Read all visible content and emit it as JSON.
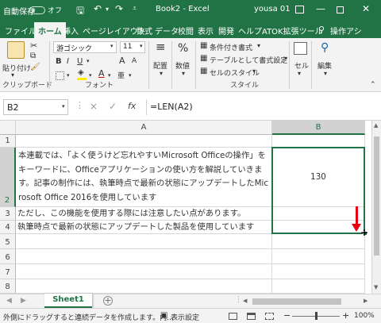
{
  "titlebar": {
    "autosave": "自動保存",
    "autosave_state": "オフ",
    "title": "Book2  -  Excel",
    "user": "yousa 01"
  },
  "tabs": [
    "ファイル",
    "ホーム",
    "挿入",
    "ページレイアウト",
    "数式",
    "データ",
    "校閲",
    "表示",
    "開発",
    "ヘルプ",
    "ATOK拡張ツール",
    "操作アシ"
  ],
  "active_tab": "ホーム",
  "ribbon": {
    "paste": "貼り付け",
    "clipboard": "クリップボード",
    "font_name": "游ゴシック",
    "font_size": "11",
    "font_group": "フォント",
    "bold": "B",
    "italic": "I",
    "underline": "U",
    "grow": "A",
    "shrink": "A",
    "font_color": "A",
    "align": "配置",
    "number": "数値",
    "cond_format": "条件付き書式",
    "table_format": "テーブルとして書式設定",
    "cell_style": "セルのスタイル",
    "style_group": "スタイル",
    "cells": "セル",
    "edit": "編集"
  },
  "formula_bar": {
    "name_box": "B2",
    "cancel": "×",
    "enter": "✓",
    "fx": "fx",
    "formula": "=LEN(A2)"
  },
  "grid": {
    "columns": [
      "A",
      "B"
    ],
    "rows": [
      "1",
      "2",
      "3",
      "4",
      "5",
      "6",
      "7",
      "8"
    ],
    "a2": "本連載では、「よく使うけど忘れやすいMicrosoft Officeの操作」をキーワードに、Officeアプリケーションの使い方を解説していきます。記事の制作には、執筆時点で最新の状態にアップデートしたMicrosoft Office 2016を使用しています",
    "b2": "130",
    "a3": "ただし、この機能を使用する際には注意したい点があります。",
    "a4": "執筆時点で最新の状態にアップデートした製品を使用しています"
  },
  "sheet_tab": "Sheet1",
  "status": {
    "message": "外側にドラッグすると連続データを作成します。内...",
    "display_settings": "表示設定",
    "minus": "−",
    "plus": "+",
    "zoom": "100%"
  },
  "colors": {
    "brand": "#217346",
    "arrow": "#e60012"
  }
}
